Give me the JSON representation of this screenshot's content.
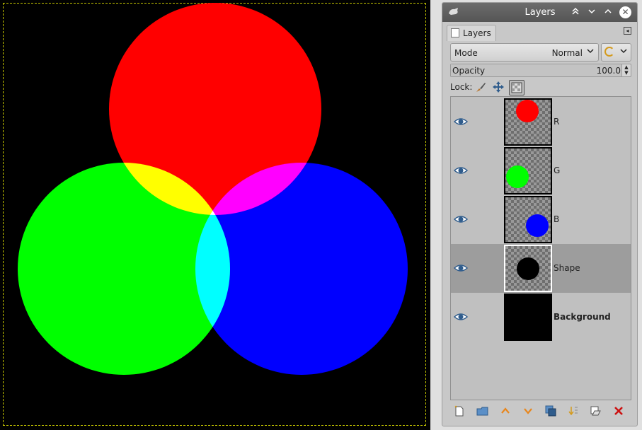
{
  "canvas": {
    "background": "#000000",
    "circles": [
      {
        "name": "red-circle",
        "color": "#ff0000"
      },
      {
        "name": "green-circle",
        "color": "#00ff00"
      },
      {
        "name": "blue-circle",
        "color": "#0000ff"
      }
    ]
  },
  "dock": {
    "title": "Layers",
    "tab_label": "Layers",
    "mode_label": "Mode",
    "mode_value": "Normal",
    "opacity_label": "Opacity",
    "opacity_value": "100.0",
    "lock_label": "Lock:"
  },
  "layers": [
    {
      "name": "R",
      "visible": true,
      "thumb_color": "#ff0000",
      "selected": false
    },
    {
      "name": "G",
      "visible": true,
      "thumb_color": "#00ff00",
      "selected": false
    },
    {
      "name": "B",
      "visible": true,
      "thumb_color": "#0000ff",
      "selected": false
    },
    {
      "name": "Shape",
      "visible": true,
      "thumb_color": "#000000",
      "selected": true
    },
    {
      "name": "Background",
      "visible": true,
      "thumb_color": "#000000",
      "selected": false
    }
  ],
  "icons": {
    "titlebar": [
      "gimp-icon",
      "scroll-up-icon",
      "chevron-down-icon",
      "chevron-up-icon",
      "close-icon"
    ],
    "toolbar": [
      "new-layer-icon",
      "new-group-icon",
      "raise-layer-icon",
      "lower-layer-icon",
      "duplicate-layer-icon",
      "anchor-layer-icon",
      "layer-mask-icon",
      "delete-layer-icon"
    ]
  },
  "colors": {
    "accent_orange": "#e8871e",
    "delete_red": "#cc1111",
    "eye_blue": "#2f5c8c"
  }
}
